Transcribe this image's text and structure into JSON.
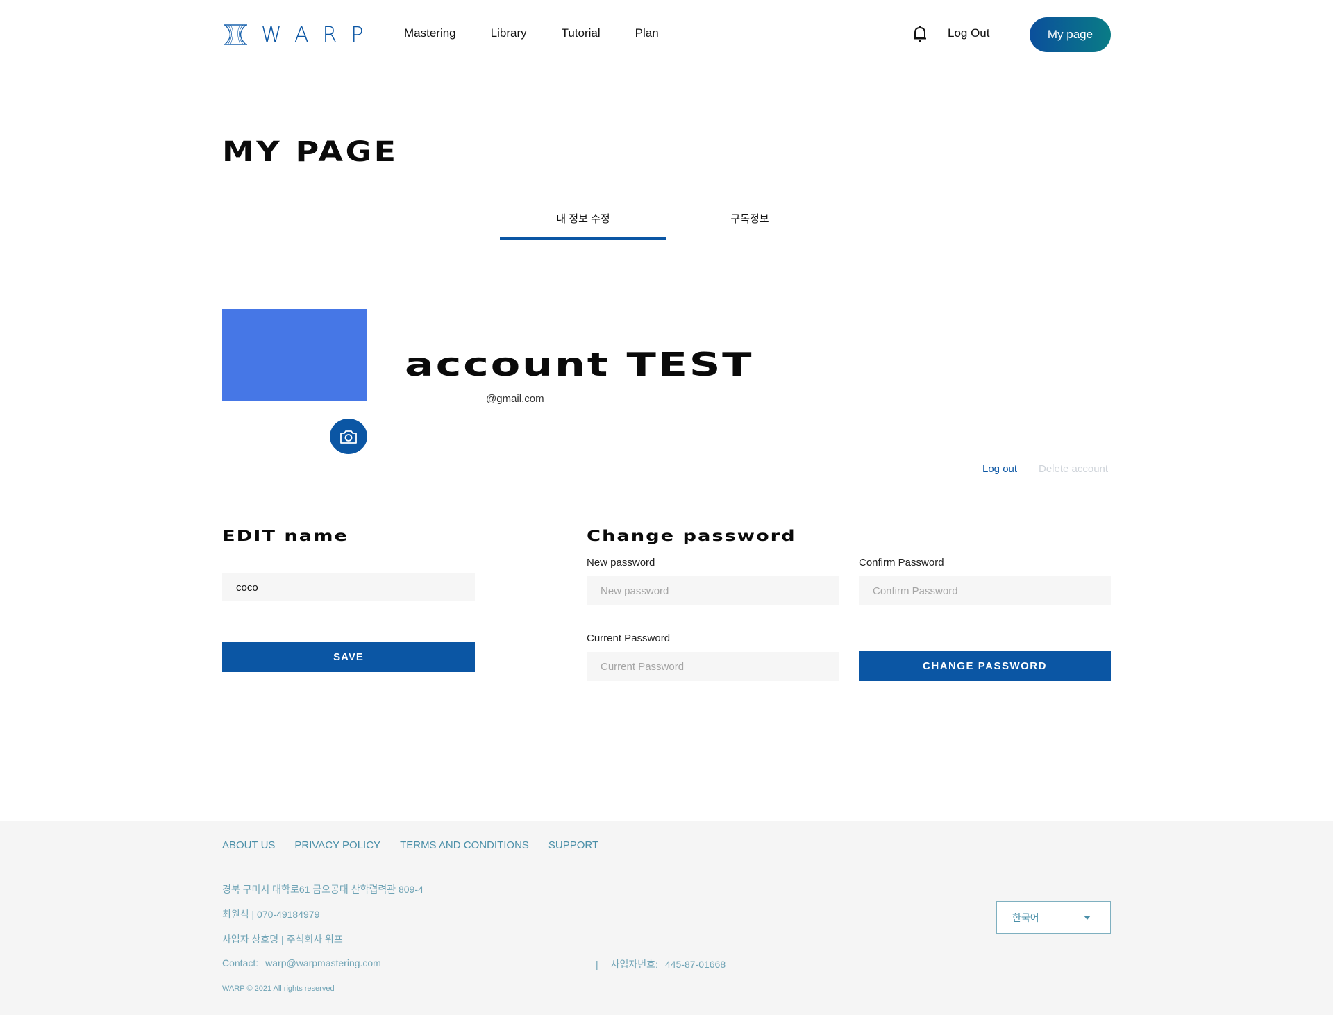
{
  "header": {
    "logo_text": "WARP",
    "nav": [
      "Mastering",
      "Library",
      "Tutorial",
      "Plan"
    ],
    "logout": "Log Out",
    "mypage": "My page"
  },
  "page_title": "MY PAGE",
  "tabs": [
    {
      "label": "내 정보 수정",
      "active": true
    },
    {
      "label": "구독정보",
      "active": false
    }
  ],
  "profile": {
    "name": "account TEST",
    "email": "@gmail.com",
    "logout_link": "Log out",
    "delete_link": "Delete account"
  },
  "edit_name": {
    "title": "EDIT name",
    "value": "coco",
    "save_label": "SAVE"
  },
  "change_password": {
    "title": "Change password",
    "new_label": "New password",
    "new_placeholder": "New password",
    "confirm_label": "Confirm Password",
    "confirm_placeholder": "Confirm Password",
    "current_label": "Current Password",
    "current_placeholder": "Current Password",
    "button_label": "CHANGE PASSWORD"
  },
  "footer": {
    "links": [
      "ABOUT US",
      "PRIVACY POLICY",
      "TERMS AND CONDITIONS",
      "SUPPORT"
    ],
    "address": "경북 구미시 대학로61 금오공대 산학렵력관 809-4",
    "phone": "최원석 | 070-49184979",
    "company": "사업자 상호명 | 주식회사 워프",
    "contact_label": "Contact:",
    "contact_email": "warp@warpmastering.com",
    "biz_sep": "|",
    "biz_label": "사업자번호:",
    "biz_number": "445-87-01668",
    "copyright": "WARP © 2021 All rights reserved",
    "language": "한국어"
  },
  "colors": {
    "accent": "#0b56a4",
    "avatar": "#4677e6",
    "footer_text": "#6fa3b5"
  }
}
